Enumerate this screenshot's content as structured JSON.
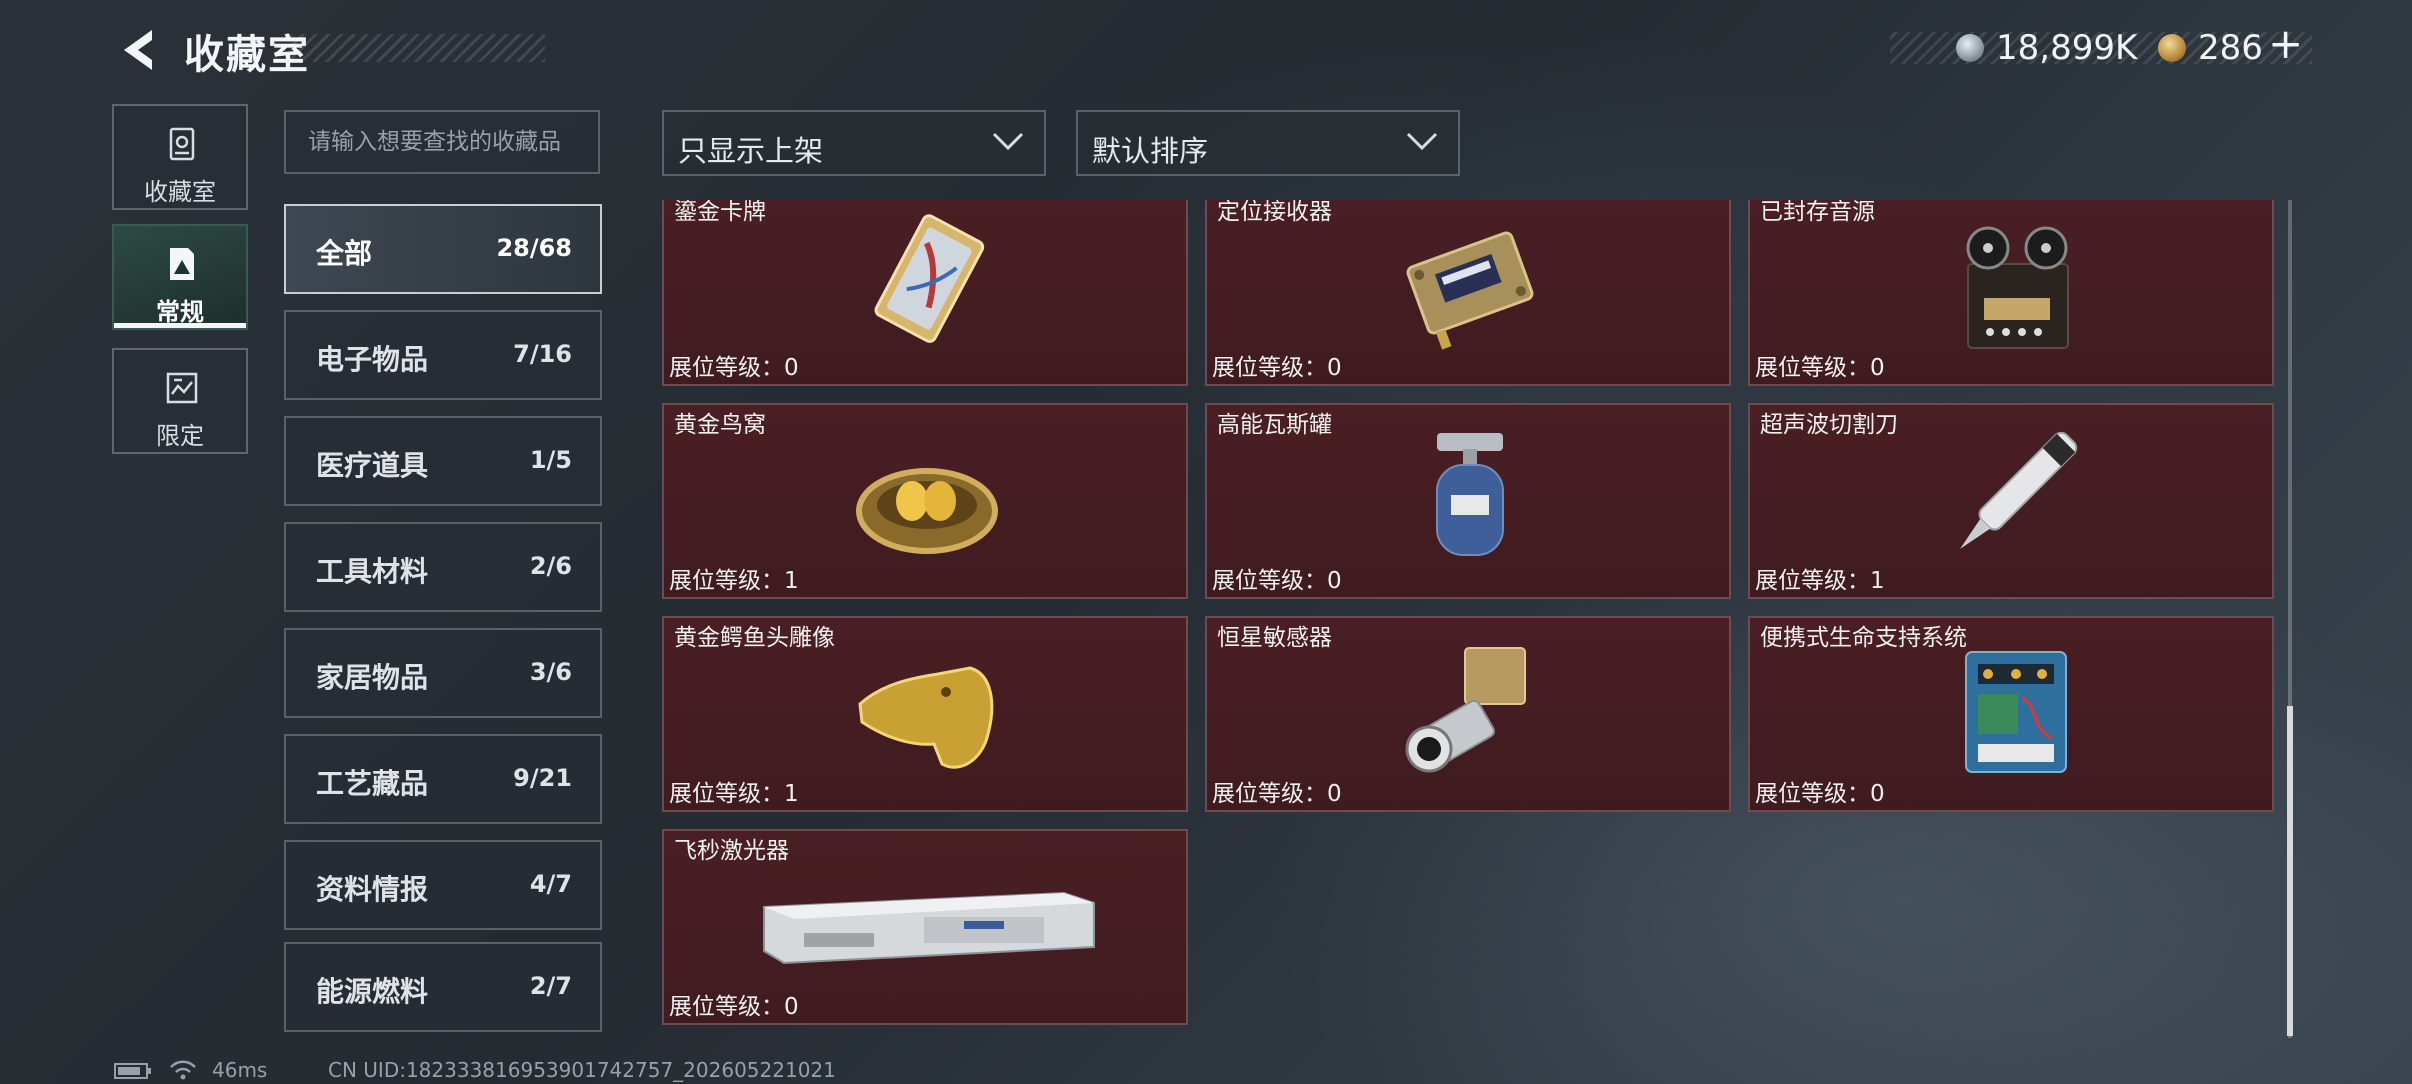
{
  "header": {
    "title": "收藏室",
    "currency1": "18,899K",
    "currency2": "286",
    "add_label": "+"
  },
  "sidebar": {
    "tabs": [
      {
        "label": "收藏室",
        "icon": "gallery-icon"
      },
      {
        "label": "常规",
        "icon": "regular-collection-icon",
        "active": true
      },
      {
        "label": "限定",
        "icon": "limited-collection-icon"
      }
    ]
  },
  "search": {
    "placeholder": "请输入想要查找的收藏品"
  },
  "categories": [
    {
      "name": "全部",
      "count": "28/68",
      "active": true
    },
    {
      "name": "电子物品",
      "count": "7/16"
    },
    {
      "name": "医疗道具",
      "count": "1/5"
    },
    {
      "name": "工具材料",
      "count": "2/6"
    },
    {
      "name": "家居物品",
      "count": "3/6"
    },
    {
      "name": "工艺藏品",
      "count": "9/21"
    },
    {
      "name": "资料情报",
      "count": "4/7"
    },
    {
      "name": "能源燃料",
      "count": "2/7"
    }
  ],
  "filters": {
    "filter_value": "只显示上架",
    "sort_value": "默认排序"
  },
  "items": [
    {
      "name": "鎏金卡牌",
      "level": "展位等级：0",
      "icon": "gilded-card-icon"
    },
    {
      "name": "定位接收器",
      "level": "展位等级：0",
      "icon": "locator-receiver-icon"
    },
    {
      "name": "已封存音源",
      "level": "展位等级：0",
      "icon": "reel-tape-recorder-icon"
    },
    {
      "name": "黄金鸟窝",
      "level": "展位等级：1",
      "icon": "golden-nest-icon"
    },
    {
      "name": "高能瓦斯罐",
      "level": "展位等级：0",
      "icon": "gas-canister-icon"
    },
    {
      "name": "超声波切割刀",
      "level": "展位等级：1",
      "icon": "ultrasonic-knife-icon"
    },
    {
      "name": "黄金鳄鱼头雕像",
      "level": "展位等级：1",
      "icon": "golden-crocodile-head-icon"
    },
    {
      "name": "恒星敏感器",
      "level": "展位等级：0",
      "icon": "star-sensor-icon"
    },
    {
      "name": "便携式生命支持系统",
      "level": "展位等级：0",
      "icon": "life-support-system-icon"
    },
    {
      "name": "飞秒激光器",
      "level": "展位等级：0",
      "icon": "femtosecond-laser-icon"
    }
  ],
  "status": {
    "ping": "46ms",
    "uid": "CN UID:182333816953901742757_202605221021"
  },
  "colors": {
    "card_bg": "#4a1f24",
    "card_border": "#6e4b4f",
    "active_tab": "#2c4a45"
  }
}
